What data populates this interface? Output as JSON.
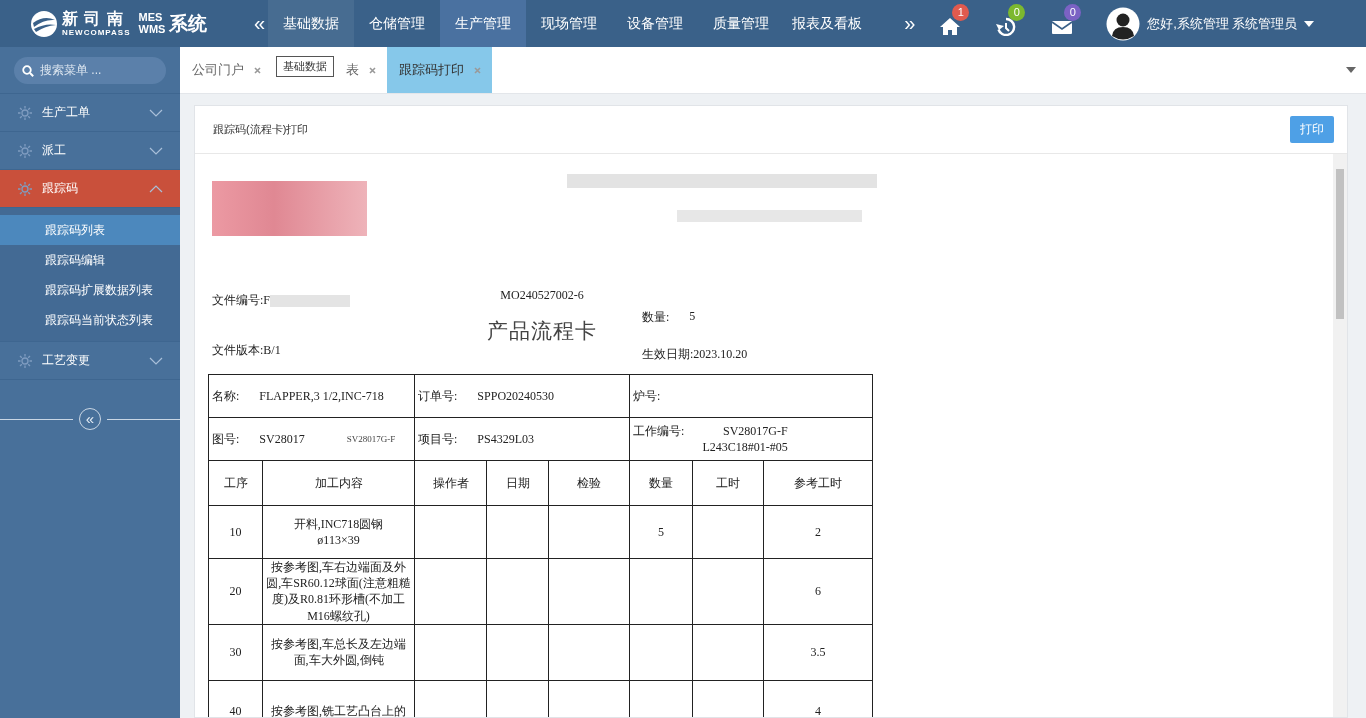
{
  "header": {
    "logo": {
      "name": "新 司 南",
      "sub": "NEWCOMPASS",
      "mes": "MES",
      "wms": "WMS",
      "suffix": "系统"
    },
    "scroll_left": "«",
    "menu": [
      {
        "label": "基础数据",
        "selected": false,
        "hovered": true
      },
      {
        "label": "仓储管理",
        "selected": false,
        "hovered": false
      },
      {
        "label": "生产管理",
        "selected": true,
        "hovered": false
      },
      {
        "label": "现场管理",
        "selected": false,
        "hovered": false
      },
      {
        "label": "设备管理",
        "selected": false,
        "hovered": false
      },
      {
        "label": "质量管理",
        "selected": false,
        "hovered": false
      },
      {
        "label": "报表及看板",
        "selected": false,
        "hovered": false
      }
    ],
    "scroll_right": "»",
    "notifications": [
      {
        "kind": "home",
        "count": "1",
        "color": "#e05a4e"
      },
      {
        "kind": "history",
        "count": "0",
        "color": "#7cb82f"
      },
      {
        "kind": "mail",
        "count": "0",
        "color": "#7b62c4"
      }
    ],
    "user": "您好,系统管理 系统管理员"
  },
  "sidebar": {
    "search_placeholder": "搜索菜单 ...",
    "items": [
      {
        "label": "生产工单",
        "expanded": false,
        "selected": false
      },
      {
        "label": "派工",
        "expanded": false,
        "selected": false
      },
      {
        "label": "跟踪码",
        "expanded": true,
        "selected": true,
        "children": [
          {
            "label": "跟踪码列表",
            "selected": true
          },
          {
            "label": "跟踪码编辑",
            "selected": false
          },
          {
            "label": "跟踪码扩展数据列表",
            "selected": false
          },
          {
            "label": "跟踪码当前状态列表",
            "selected": false
          }
        ]
      },
      {
        "label": "工艺变更",
        "expanded": false,
        "selected": false
      }
    ],
    "collapse": "«"
  },
  "tabs": [
    {
      "label": "公司门户",
      "selected": false
    },
    {
      "label": "表",
      "selected": false
    },
    {
      "label": "跟踪码打印",
      "selected": true
    }
  ],
  "tooltip": "基础数据",
  "panel": {
    "title": "跟踪码(流程卡)打印",
    "print_button": "打印"
  },
  "document": {
    "file_no_label": "文件编号:F",
    "order_code": "MO240527002-6",
    "title": "产品流程卡",
    "version": "文件版本:B/1",
    "qty_label": "数量:",
    "qty": "5",
    "date": "生效日期:2023.10.20",
    "info": [
      [
        {
          "label": "名称:",
          "values": [
            "FLAPPER,3 1/2,INC-718"
          ]
        },
        {
          "label": "订单号:",
          "values": [
            "SPPO20240530"
          ]
        },
        {
          "label": "炉号:"
        }
      ],
      [
        {
          "label": "图号:",
          "values": [
            "SV28017",
            "SV28017G-F"
          ]
        },
        {
          "label": "项目号:",
          "values": [
            "PS4329L03"
          ]
        },
        {
          "label": "工作编号:",
          "values": [
            "SV28017G-F",
            "L243C18#01-#05"
          ]
        }
      ]
    ],
    "columns": [
      "工序",
      "加工内容",
      "操作者",
      "日期",
      "检验",
      "数量",
      "工时",
      "参考工时"
    ],
    "rows": [
      [
        "10",
        "开料,INC718圆钢\nø113×39",
        "",
        "",
        "",
        "5",
        "",
        "2"
      ],
      [
        "20",
        "按参考图,车右边端面及外圆,车SR60.12球面(注意粗糙度)及R0.81环形槽(不加工M16螺纹孔)",
        "",
        "",
        "",
        "",
        "",
        "6"
      ],
      [
        "30",
        "按参考图,车总长及左边端面,车大外圆,倒钝",
        "",
        "",
        "",
        "",
        "",
        "3.5"
      ],
      [
        "40",
        "按参考图,铣工艺凸台上的",
        "",
        "",
        "",
        "",
        "",
        "4"
      ]
    ]
  }
}
